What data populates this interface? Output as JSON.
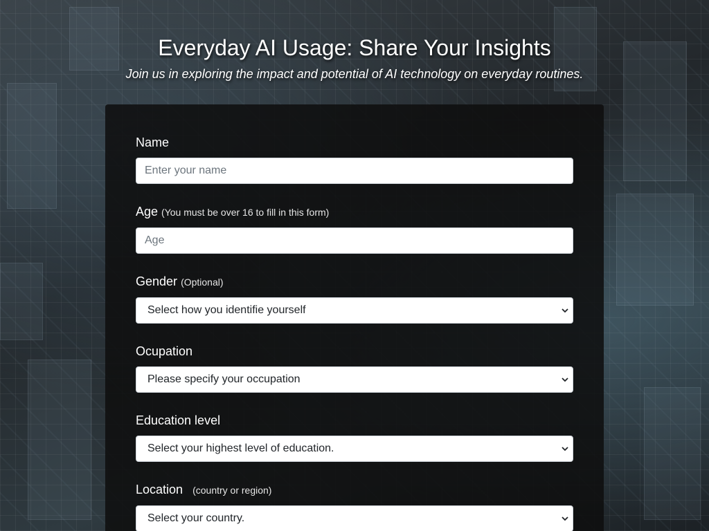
{
  "header": {
    "title": "Everyday AI Usage: Share Your Insights",
    "subtitle": "Join us in exploring the impact and potential of AI technology on everyday routines."
  },
  "form": {
    "name": {
      "label": "Name",
      "placeholder": "Enter your name"
    },
    "age": {
      "label": "Age",
      "hint": "(You must be over 16 to fill in this form)",
      "placeholder": "Age"
    },
    "gender": {
      "label": "Gender",
      "hint": "(Optional)",
      "selected": "Select how you identifie yourself",
      "icon": "chevron-down-icon"
    },
    "occupation": {
      "label": "Ocupation",
      "selected": "Please specify your occupation",
      "icon": "chevron-down-icon"
    },
    "education": {
      "label": "Education level",
      "selected": "Select your highest level of education.",
      "icon": "chevron-down-icon"
    },
    "location": {
      "label": "Location",
      "hint": "(country or region)",
      "selected": "Select your country.",
      "icon": "chevron-down-icon"
    }
  },
  "colors": {
    "panel_background": "#0e0e0e",
    "text": "#ffffff",
    "input_border": "#ced4da"
  }
}
